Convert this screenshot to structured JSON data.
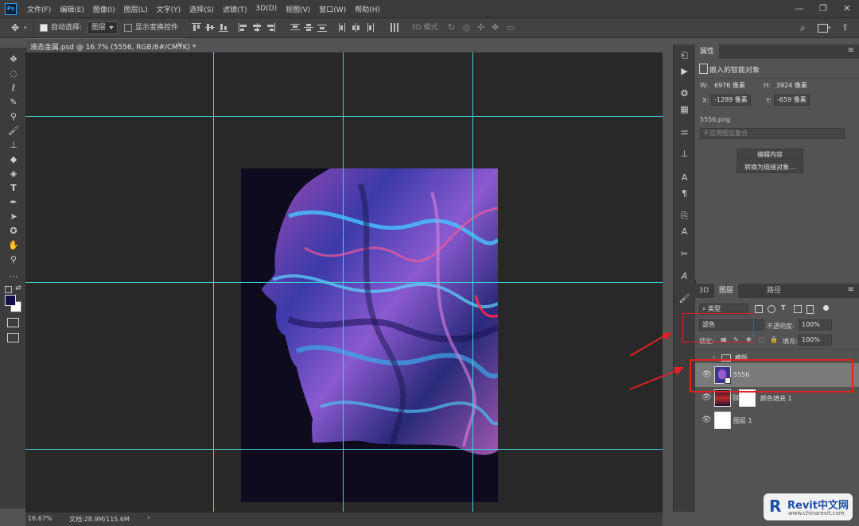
{
  "app": {
    "logo": "Ps"
  },
  "menu": [
    "文件(F)",
    "编辑(E)",
    "图像(I)",
    "图层(L)",
    "文字(Y)",
    "选择(S)",
    "滤镜(T)",
    "3D(D)",
    "视图(V)",
    "窗口(W)",
    "帮助(H)"
  ],
  "window_controls": {
    "minimize": "—",
    "restore": "❐",
    "close": "✕"
  },
  "options": {
    "tool_icon": "move-icon",
    "auto_select_label": "自动选择:",
    "auto_select_checked": true,
    "auto_select_target": "图层",
    "show_transform_label": "显示变换控件",
    "mode_3d_label": "3D 模式:"
  },
  "document": {
    "tab_title": "液态金属.psd @ 16.7% (5556, RGB/8#/CMYK) *",
    "close": "×"
  },
  "status": {
    "zoom": "16.67%",
    "doc_size": "文档:28.9M/115.6M",
    "arrow": "›"
  },
  "properties": {
    "tab": "属性",
    "type": "嵌入的智能对象",
    "w_label": "W:",
    "w_value": "6976 像素",
    "h_label": "H:",
    "h_value": "3924 像素",
    "x_label": "X:",
    "x_value": "-1289 像素",
    "y_label": "Y:",
    "y_value": "-659 像素",
    "filename": "5556.png",
    "comp_placeholder": "不应用图层复合",
    "edit_contents": "编辑内容",
    "convert_linked": "转换为链接对象..."
  },
  "layers_panel": {
    "tabs": [
      "3D",
      "图层",
      "路径"
    ],
    "filter_kind": "类型",
    "blend_mode": "滤色",
    "opacity_label": "不透明度:",
    "opacity_value": "100%",
    "lock_label": "锁定:",
    "fill_label": "填充:",
    "fill_value": "100%",
    "layers": [
      {
        "name": "模版",
        "type": "group",
        "visible": false
      },
      {
        "name": "5556",
        "type": "smart-object",
        "visible": true,
        "selected": true
      },
      {
        "name": "颜色填充 1",
        "type": "fill",
        "visible": true
      },
      {
        "name": "图层 1",
        "type": "pixel",
        "visible": true
      }
    ]
  },
  "watermark": {
    "logo": "R",
    "title": "Revit中文网",
    "url": "www.chinarevit.com"
  },
  "colors": {
    "foreground": "#14104a",
    "background": "#ffffff",
    "guide": "#3fd3d6",
    "highlight": "#e02222"
  }
}
